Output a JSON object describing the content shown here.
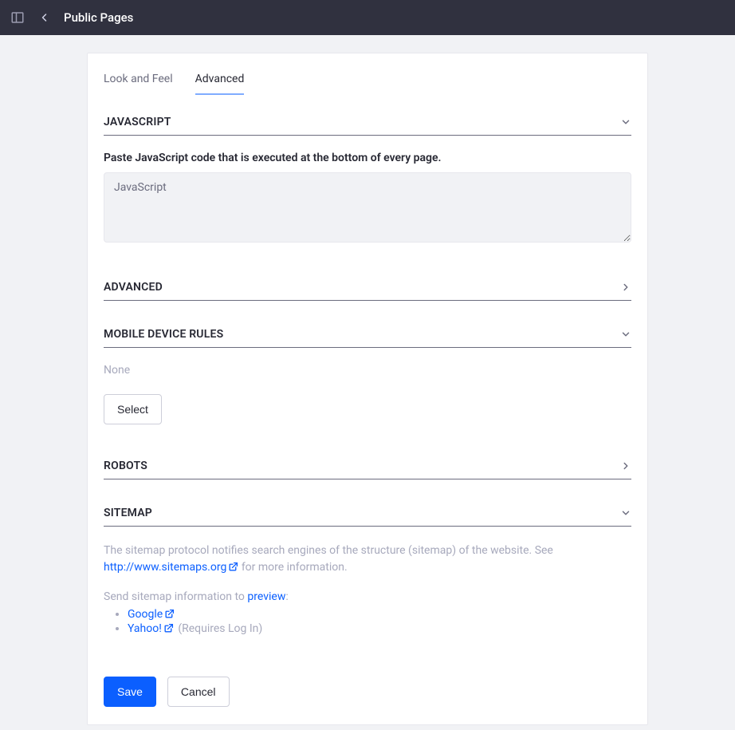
{
  "header": {
    "title": "Public Pages"
  },
  "tabs": [
    {
      "label": "Look and Feel",
      "active": false
    },
    {
      "label": "Advanced",
      "active": true
    }
  ],
  "sections": {
    "javascript": {
      "title": "JAVASCRIPT",
      "expanded": true,
      "label": "Paste JavaScript code that is executed at the bottom of every page.",
      "placeholder": "JavaScript",
      "value": ""
    },
    "advanced": {
      "title": "ADVANCED",
      "expanded": false
    },
    "mobile": {
      "title": "MOBILE DEVICE RULES",
      "expanded": true,
      "none_text": "None",
      "select_label": "Select"
    },
    "robots": {
      "title": "ROBOTS",
      "expanded": false
    },
    "sitemap": {
      "title": "SITEMAP",
      "expanded": true,
      "desc_prefix": "The sitemap protocol notifies search engines of the structure (sitemap) of the website. See ",
      "link_text": "http://www.sitemaps.org",
      "desc_suffix": " for more information.",
      "send_prefix": "Send sitemap information to ",
      "preview_link": "preview",
      "send_suffix": ":",
      "providers": {
        "google": "Google",
        "yahoo": "Yahoo!",
        "yahoo_note": "(Requires Log In)"
      }
    }
  },
  "actions": {
    "save": "Save",
    "cancel": "Cancel"
  }
}
